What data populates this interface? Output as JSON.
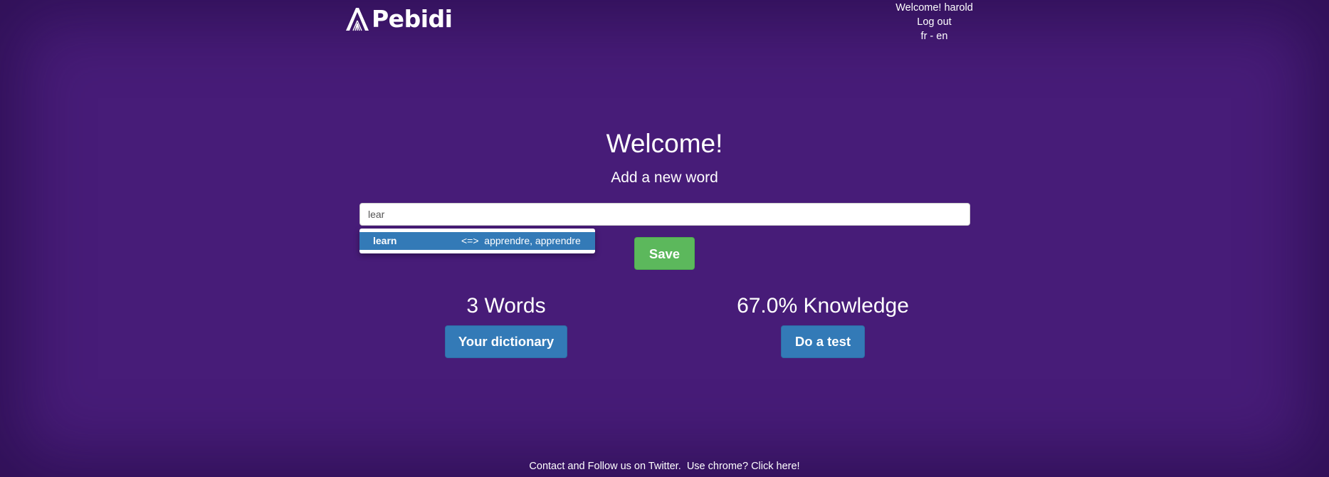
{
  "header": {
    "logo_text": "Pebidi",
    "welcome_text": "Welcome! harold",
    "logout_label": "Log out",
    "lang_fr": "fr",
    "lang_separator": " - ",
    "lang_en": "en"
  },
  "main": {
    "title": "Welcome!",
    "subtitle": "Add a new word",
    "word_input_value": "lear",
    "autocomplete": [
      {
        "word": "learn",
        "translation": "<=>  apprendre, apprendre"
      }
    ],
    "save_label": "Save"
  },
  "stats": {
    "words_text": "3 Words",
    "dictionary_button": "Your dictionary",
    "knowledge_text": "67.0% Knowledge",
    "test_button": "Do a test"
  },
  "footer": {
    "contact_text": "Contact and Follow us on Twitter.",
    "chrome_text": "Use chrome? Click here!"
  },
  "colors": {
    "background": "#471c78",
    "primary": "#337ab7",
    "success": "#5cb85c"
  }
}
